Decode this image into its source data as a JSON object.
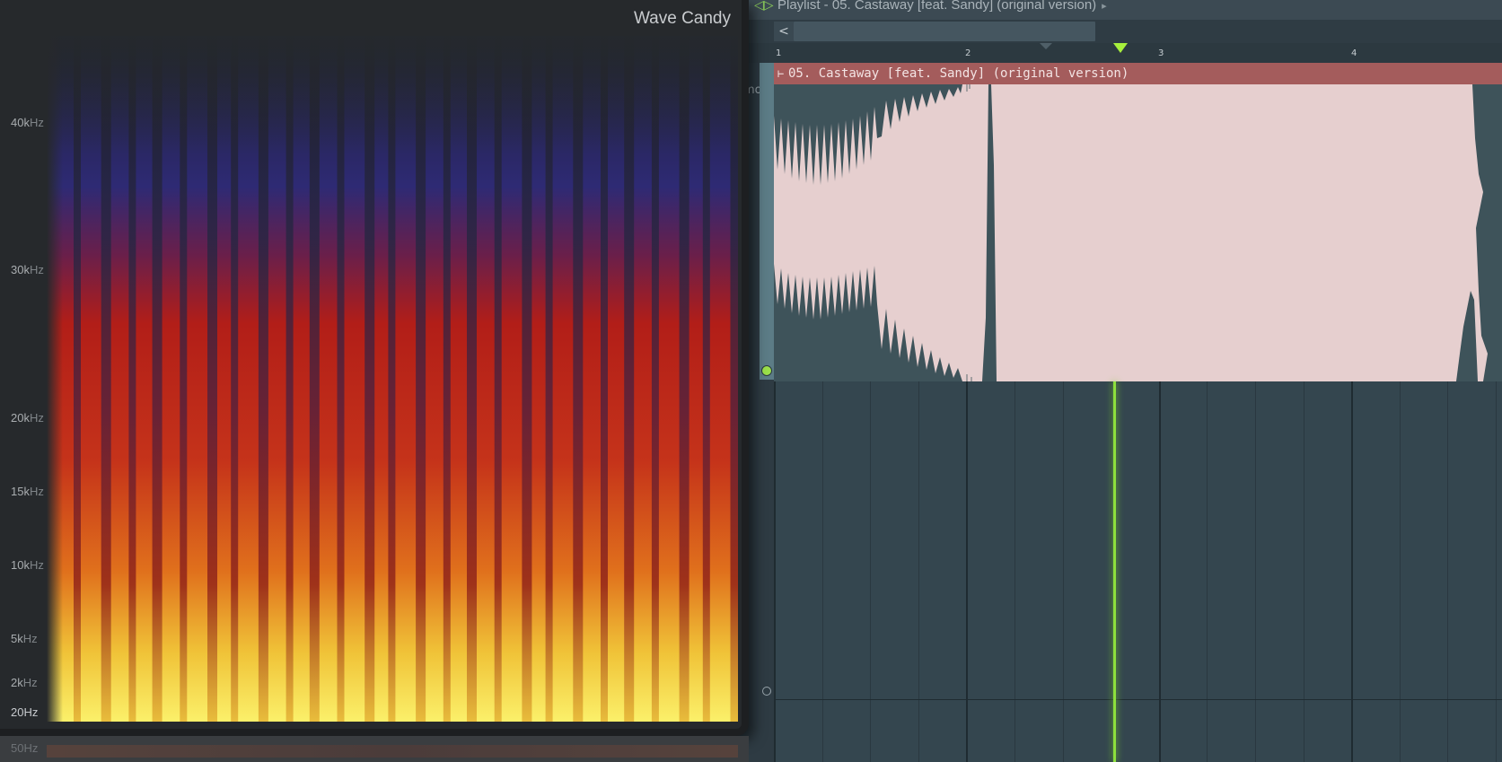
{
  "playlist": {
    "title": "Playlist - 05. Castaway [feat. Sandy] (original version)",
    "back_glyph": "<",
    "ruler_numbers": [
      "1",
      "2",
      "3",
      "4"
    ],
    "track_stub": "emo",
    "clip": {
      "name": "05. Castaway [feat. Sandy] (original version)",
      "color": "#a45c5c",
      "fill": "#e6cfcf"
    },
    "playhead_color": "#8de03c"
  },
  "wave_candy": {
    "title": "Wave Candy",
    "freq_labels": [
      {
        "value": "40k",
        "unit": "Hz"
      },
      {
        "value": "30k",
        "unit": "Hz"
      },
      {
        "value": "20k",
        "unit": "Hz"
      },
      {
        "value": "15k",
        "unit": "Hz"
      },
      {
        "value": "10k",
        "unit": "Hz"
      },
      {
        "value": "5k",
        "unit": "Hz"
      },
      {
        "value": "2k",
        "unit": "Hz"
      },
      {
        "value": "20",
        "unit": "Hz"
      }
    ],
    "ghost_label": "50Hz",
    "colors": {
      "low": "#f2e24a",
      "mid": "#c41f1a",
      "high": "#2a2a70"
    }
  }
}
